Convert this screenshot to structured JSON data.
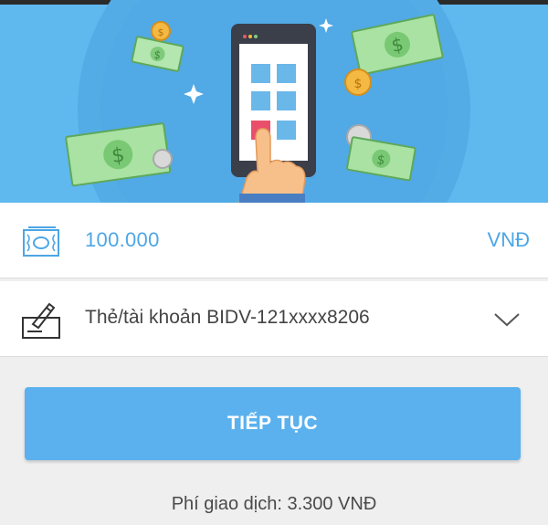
{
  "hero": {
    "illustration_icon": "phone-with-money-illustration",
    "background_color": "#5fb8ee"
  },
  "amount": {
    "icon": "banknote-icon",
    "value": "100.000",
    "currency": "VNĐ",
    "accent_color": "#4da6e6"
  },
  "account": {
    "icon": "card-sign-icon",
    "label": "Thẻ/tài khoản BIDV-121xxxx8206",
    "dropdown_icon": "chevron-down-icon"
  },
  "continue_button": {
    "label": "TIẾP TỤC",
    "color": "#5bb1ee"
  },
  "fee": {
    "text": "Phí giao dịch: 3.300 VNĐ"
  }
}
